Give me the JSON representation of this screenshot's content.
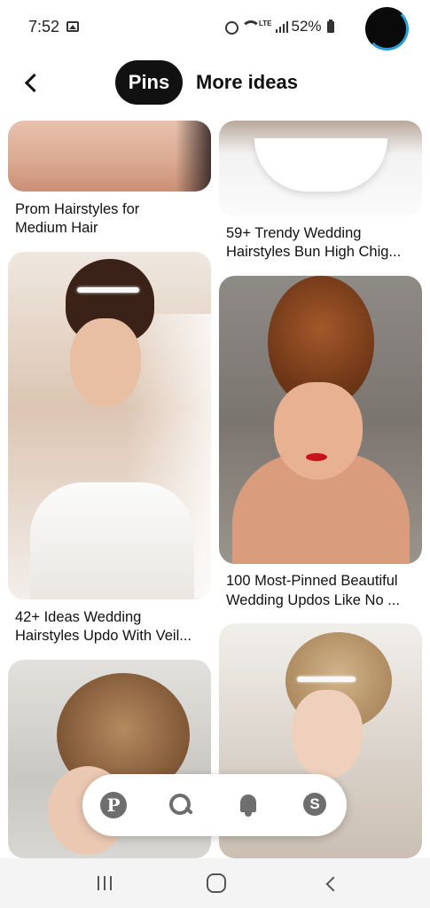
{
  "status_bar": {
    "time": "7:52",
    "network": "LTE",
    "battery": "52%"
  },
  "header": {
    "active_tab": "Pins",
    "other_tab": "More ideas"
  },
  "pins": [
    {
      "caption_lines": [
        "Prom Hairstyles for",
        "Medium Hair"
      ]
    },
    {
      "caption_lines": [
        "59+ Trendy Wedding",
        "Hairstyles Bun High Chig..."
      ]
    },
    {
      "caption_lines": [
        "42+ Ideas Wedding",
        "Hairstyles Updo With Veil..."
      ]
    },
    {
      "caption_lines": [
        "100 Most-Pinned Beautiful",
        "Wedding Updos Like No ..."
      ]
    }
  ],
  "bottom_nav": {
    "items": [
      "pinterest-home",
      "search",
      "notifications",
      "messages"
    ]
  },
  "colors": {
    "active_tab_bg": "#111111",
    "avatar_ring": "#2a9fd6",
    "nav_icon": "#6e6e6e"
  }
}
